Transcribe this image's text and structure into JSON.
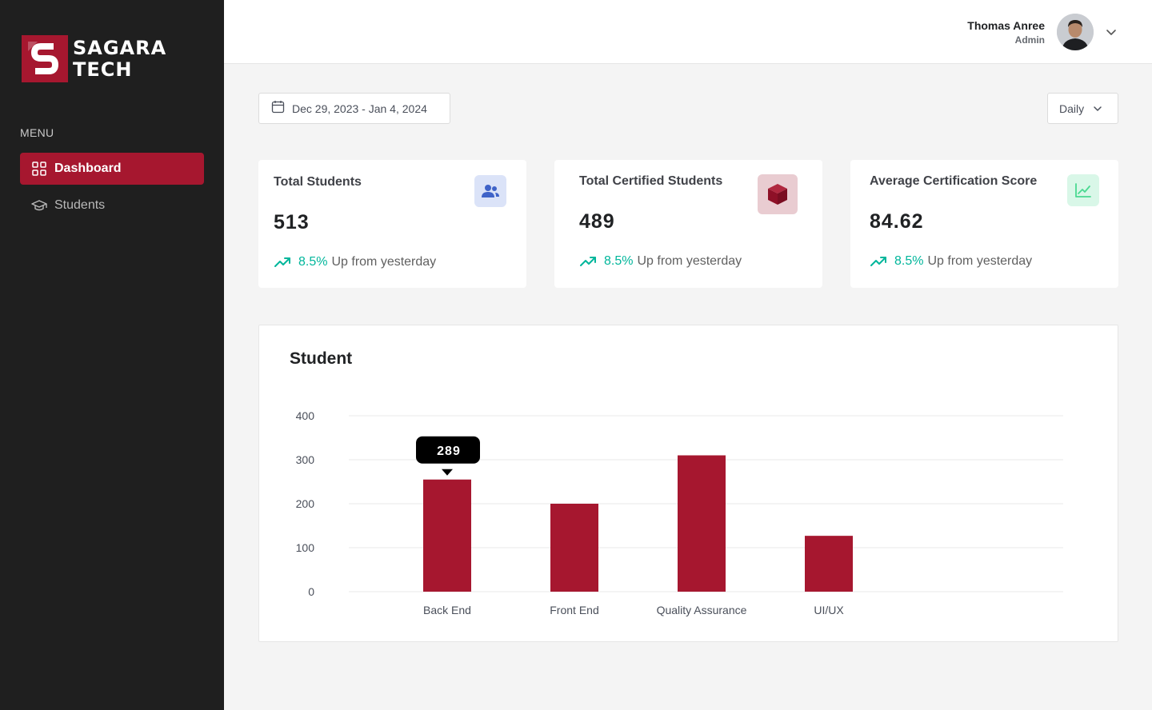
{
  "brand": {
    "line1": "SAGARA",
    "line2": "TECH"
  },
  "sidebar": {
    "menu_label": "MENU",
    "items": [
      {
        "label": "Dashboard",
        "icon": "grid-icon",
        "active": true
      },
      {
        "label": "Students",
        "icon": "graduation-cap-icon",
        "active": false
      }
    ]
  },
  "header": {
    "user_name": "Thomas Anree",
    "user_role": "Admin"
  },
  "filters": {
    "date_range": "Dec 29, 2023 - Jan 4, 2024",
    "period": "Daily"
  },
  "stats": [
    {
      "title": "Total Students",
      "value": "513",
      "trend_pct": "8.5%",
      "trend_text": "Up from yesterday",
      "icon": "users-icon",
      "icon_bg": "#dbe3f8",
      "icon_color": "#3f63c8"
    },
    {
      "title": "Total Certified Students",
      "value": "489",
      "trend_pct": "8.5%",
      "trend_text": "Up from yesterday",
      "icon": "cube-icon",
      "icon_bg": "#e9ccd1",
      "icon_color": "#8e1027"
    },
    {
      "title": "Average Certification Score",
      "value": "84.62",
      "trend_pct": "8.5%",
      "trend_text": "Up from yesterday",
      "icon": "line-chart-icon",
      "icon_bg": "#d9f7e8",
      "icon_color": "#4ad991"
    }
  ],
  "colors": {
    "brand": "#a6172f",
    "sidebar_bg": "#1f1f1f",
    "trend_up": "#00b69b"
  },
  "chart_data": {
    "type": "bar",
    "title": "Student",
    "categories": [
      "Back End",
      "Front End",
      "Quality Assurance",
      "UI/UX"
    ],
    "values": [
      255,
      200,
      310,
      127
    ],
    "ylim": [
      0,
      400
    ],
    "yticks": [
      0,
      100,
      200,
      300,
      400
    ],
    "tooltip": {
      "category": "Back End",
      "label": "289"
    },
    "bar_color": "#a6172f",
    "grid": true
  }
}
